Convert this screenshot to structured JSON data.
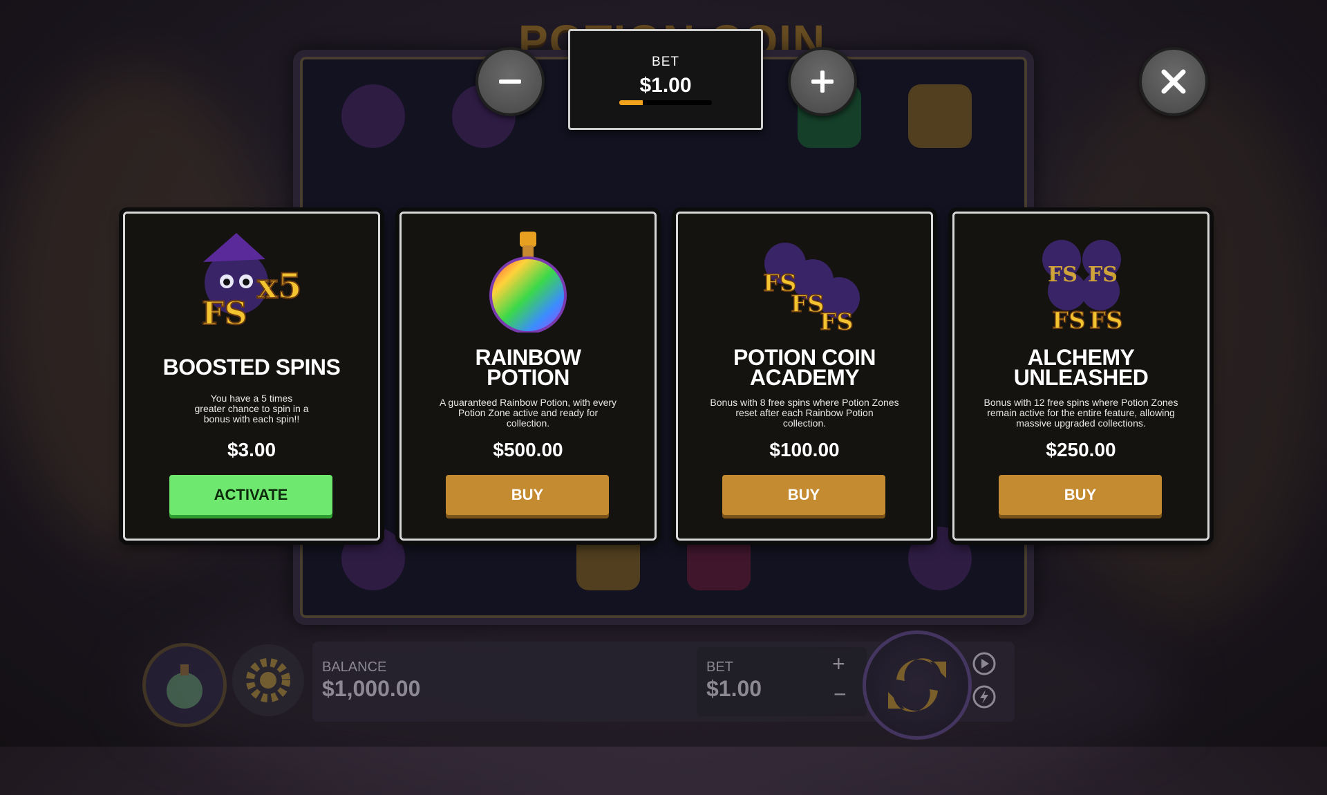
{
  "game": {
    "logo_text": "POTION COIN"
  },
  "bet_control": {
    "label": "BET",
    "value": "$1.00",
    "level_fraction": 0.25,
    "minus_icon": "minus-icon",
    "plus_icon": "plus-icon"
  },
  "close_icon": "close-icon",
  "cards": [
    {
      "title_lines": [
        "BOOSTED SPINS"
      ],
      "description_lines": [
        "You have a 5 times",
        "greater chance to spin in a",
        "bonus with each spin!!"
      ],
      "price": "$3.00",
      "button_label": "ACTIVATE",
      "art_text": [
        "FS",
        "x5"
      ]
    },
    {
      "title_lines": [
        "RAINBOW",
        "POTION"
      ],
      "description_lines": [
        "A guaranteed Rainbow Potion, with every",
        "Potion Zone active and ready for",
        "collection."
      ],
      "price": "$500.00",
      "button_label": "BUY",
      "art_text": []
    },
    {
      "title_lines": [
        "POTION COIN",
        "ACADEMY"
      ],
      "description_lines": [
        "Bonus with 8 free spins where Potion Zones",
        "reset after each Rainbow Potion",
        "collection."
      ],
      "price": "$100.00",
      "button_label": "BUY",
      "art_text": [
        "FS",
        "FS",
        "FS"
      ]
    },
    {
      "title_lines": [
        "ALCHEMY",
        "UNLEASHED"
      ],
      "description_lines": [
        "Bonus with 12 free spins where Potion Zones",
        "remain active for the entire feature, allowing",
        "massive upgraded collections."
      ],
      "price": "$250.00",
      "button_label": "BUY",
      "art_text": [
        "FS",
        "FS",
        "FS",
        "FS"
      ]
    }
  ],
  "bottom_bar": {
    "balance_label": "BALANCE",
    "balance_value": "$1,000.00",
    "bet_label": "BET",
    "bet_value": "$1.00",
    "bet_plus": "+",
    "bet_minus": "−"
  },
  "colors": {
    "gold": "#c48b30",
    "green": "#6ee86e",
    "accent_orange": "#f0a21c"
  }
}
